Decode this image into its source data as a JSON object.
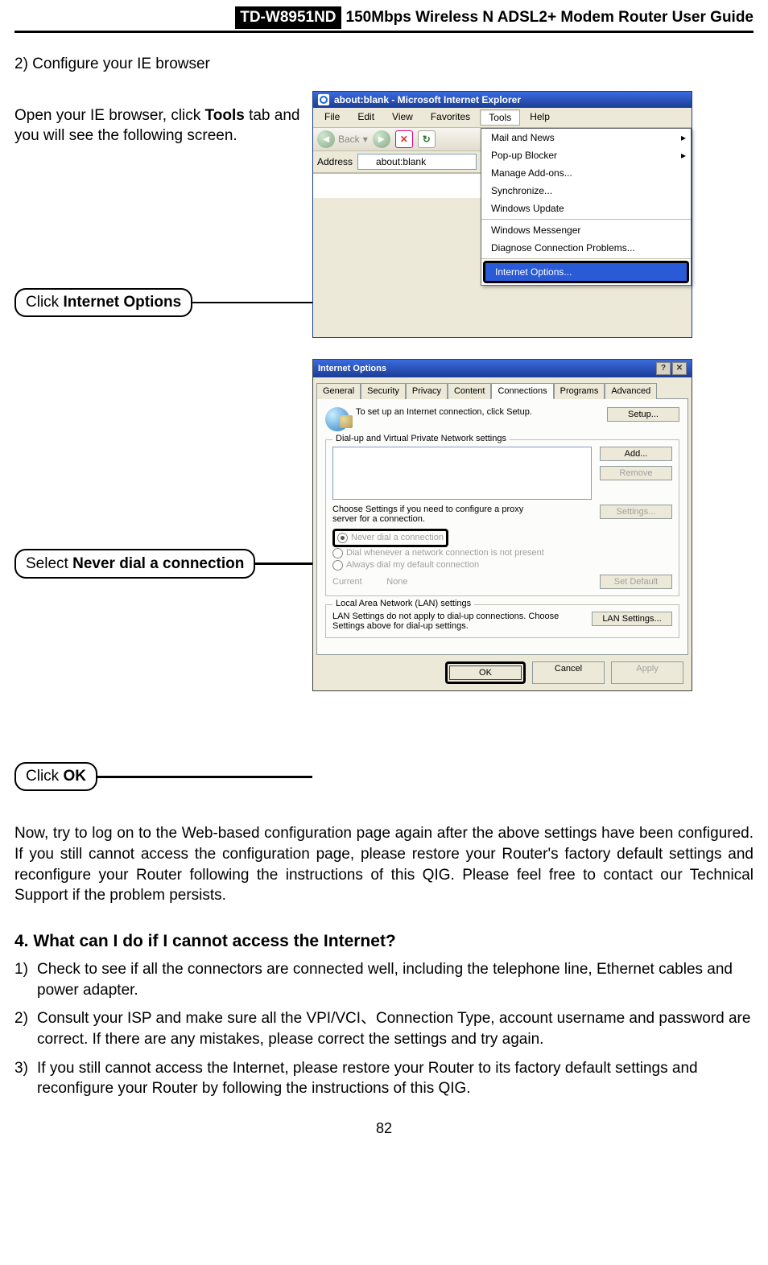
{
  "header": {
    "model": "TD-W8951ND",
    "title": "150Mbps Wireless N ADSL2+ Modem Router User Guide"
  },
  "step2_label": "2)  Configure your IE browser",
  "intro1_a": "Open your IE browser, click ",
  "intro1_b": "Tools",
  "intro1_c": " tab and you will see the following screen.",
  "annot": {
    "internet_options_a": "Click ",
    "internet_options_b": "Internet Options",
    "never_dial_a": "Select ",
    "never_dial_b": "Never dial a connection",
    "ok_a": "Click ",
    "ok_b": "OK"
  },
  "ie": {
    "title": "about:blank - Microsoft Internet Explorer",
    "menus": [
      "File",
      "Edit",
      "View",
      "Favorites",
      "Tools",
      "Help"
    ],
    "back": "Back",
    "address_label": "Address",
    "address_value": "about:blank",
    "tools_menu": {
      "mail": "Mail and News",
      "popup": "Pop-up Blocker",
      "addons": "Manage Add-ons...",
      "sync": "Synchronize...",
      "wu": "Windows Update",
      "wm": "Windows Messenger",
      "diag": "Diagnose Connection Problems...",
      "iopts": "Internet Options..."
    }
  },
  "io": {
    "title": "Internet Options",
    "tabs": [
      "General",
      "Security",
      "Privacy",
      "Content",
      "Connections",
      "Programs",
      "Advanced"
    ],
    "setup_text": "To set up an Internet connection, click Setup.",
    "setup_btn": "Setup...",
    "group_dial": "Dial-up and Virtual Private Network settings",
    "add_btn": "Add...",
    "remove_btn": "Remove",
    "settings_btn": "Settings...",
    "proxy_text": "Choose Settings if you need to configure a proxy server for a connection.",
    "radio_never": "Never dial a connection",
    "radio_when": "Dial whenever a network connection is not present",
    "radio_always": "Always dial my default connection",
    "current_label": "Current",
    "current_value": "None",
    "setdefault_btn": "Set Default",
    "group_lan": "Local Area Network (LAN) settings",
    "lan_text": "LAN Settings do not apply to dial-up connections. Choose Settings above for dial-up settings.",
    "lan_btn": "LAN Settings...",
    "ok": "OK",
    "cancel": "Cancel",
    "apply": "Apply"
  },
  "para_after": "Now, try to log on to the Web-based configuration page again after the above settings have been configured. If you still cannot access the configuration page, please restore your Router's factory default settings and reconfigure your Router following the instructions of this QIG. Please feel free to contact our Technical Support if the problem persists.",
  "section4": "4.  What can I do if I cannot access the Internet?",
  "s4_items": {
    "i1": "Check to see if all the connectors are connected well, including the telephone line, Ethernet cables and power adapter.",
    "i2": "Consult your ISP and make sure all the VPI/VCI、Connection Type, account username and password are correct. If there are any mistakes, please correct the settings and try again.",
    "i3": "If you still cannot access the Internet, please restore your Router to its factory default settings and reconfigure your Router by following the instructions of this QIG."
  },
  "page_number": "82"
}
